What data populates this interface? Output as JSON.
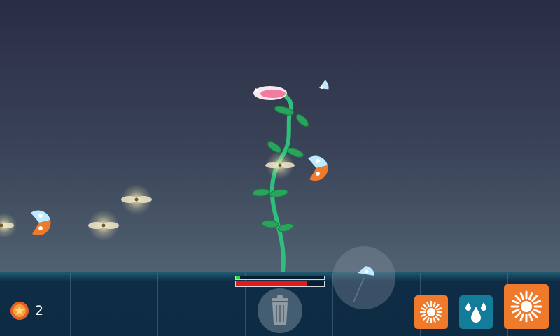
{
  "hud": {
    "score": "2",
    "growth_progress": 0.05,
    "health": 0.8
  },
  "icons": {
    "score": "fire-orb-icon",
    "trash": "trash-can-icon",
    "sun_small": "sun-icon",
    "water": "water-drops-icon",
    "sun_big": "sun-icon"
  },
  "colors": {
    "action_orange": "#f07a2b",
    "action_teal": "#137c9a",
    "health_red": "#e41a1a",
    "growth_green": "#38d44a",
    "stem_green": "#2ec07a",
    "leaf_green": "#2aa35c",
    "petal_pink": "#f27ba0",
    "seed_blue": "#bfe9ff",
    "seed_orange": "#f07a2b"
  }
}
